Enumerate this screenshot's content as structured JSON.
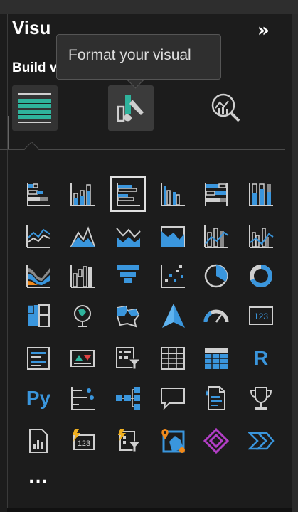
{
  "pane": {
    "title": "Visu",
    "collapse_glyph": "»",
    "subtitle": "Build visual"
  },
  "tabs": [
    {
      "name": "build-visual-tab",
      "icon": "fields-well-icon",
      "selected": true
    },
    {
      "name": "format-visual-tab",
      "icon": "paint-brush-chart-icon",
      "selected": false
    },
    {
      "name": "analytics-tab",
      "icon": "magnifier-chart-icon",
      "selected": false
    }
  ],
  "tooltip": {
    "text": "Format your visual"
  },
  "visuals": [
    "stacked-bar-chart-icon",
    "stacked-column-chart-icon",
    "clustered-bar-chart-icon",
    "clustered-column-chart-icon",
    "100-percent-stacked-bar-chart-icon",
    "100-percent-stacked-column-chart-icon",
    "line-chart-icon",
    "area-chart-icon",
    "stacked-area-chart-icon",
    "100-percent-stacked-area-chart-icon",
    "line-and-stacked-column-chart-icon",
    "line-and-clustered-column-chart-icon",
    "ribbon-chart-icon",
    "waterfall-chart-icon",
    "funnel-icon",
    "scatter-chart-icon",
    "pie-chart-icon",
    "donut-chart-icon",
    "treemap-icon",
    "map-icon",
    "filled-map-icon",
    "azure-map-icon",
    "gauge-icon",
    "card-icon",
    "multi-row-card-icon",
    "kpi-icon",
    "slicer-icon",
    "table-icon",
    "matrix-icon",
    "r-script-visual-icon",
    "python-visual-icon",
    "key-influencers-icon",
    "decomposition-tree-icon",
    "qa-icon",
    "smart-narrative-icon",
    "metrics-icon",
    "paginated-report-icon",
    "power-apps-card-icon",
    "power-apps-slicer-icon",
    "arcgis-map-icon",
    "power-apps-icon",
    "power-automate-icon"
  ],
  "labels": {
    "r": "R",
    "py": "Py",
    "card_value": "123",
    "more": "..."
  },
  "colors": {
    "accent_blue": "#3a96dd",
    "accent_teal": "#2fb39c",
    "accent_orange": "#f08a1c",
    "accent_purple": "#b23ec5",
    "icon_gray": "#cfcfcf"
  }
}
